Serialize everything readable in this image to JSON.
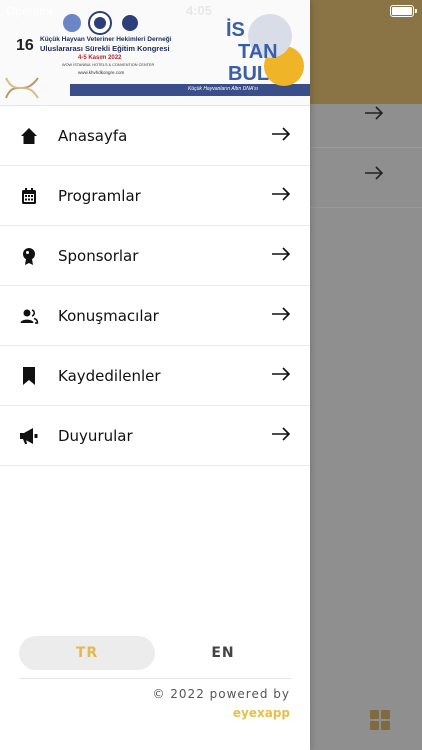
{
  "status_bar": {
    "carrier": "Operator",
    "time": "4:05"
  },
  "banner": {
    "number": "16",
    "line1": "Küçük Hayvan Veteriner Hekimleri Derneği",
    "line2": "Uluslararası Sürekli Eğitim Kongresi",
    "date": "4-5 Kasım 2022",
    "venue": "WOW İSTANBUL HOTELS & CONVENTION CENTER",
    "website": "www.khvhdkongre.com",
    "tagline": "Küçük Hayvanların Altın DNA'sı",
    "city_logo": "İSTANBUL"
  },
  "menu": {
    "items": [
      {
        "label": "Anasayfa",
        "icon": "home-icon"
      },
      {
        "label": "Programlar",
        "icon": "calendar-icon"
      },
      {
        "label": "Sponsorlar",
        "icon": "sponsor-medal-icon"
      },
      {
        "label": "Konuşmacılar",
        "icon": "speakers-icon"
      },
      {
        "label": "Kaydedilenler",
        "icon": "bookmark-icon"
      },
      {
        "label": "Duyurular",
        "icon": "megaphone-icon"
      }
    ]
  },
  "language": {
    "selected": "TR",
    "tr_label": "TR",
    "en_label": "EN"
  },
  "footer": {
    "copyright": "© 2022 powered by",
    "brand": "eyexapp"
  },
  "colors": {
    "accent": "#e7c04a",
    "header_bg": "#8a7446"
  }
}
